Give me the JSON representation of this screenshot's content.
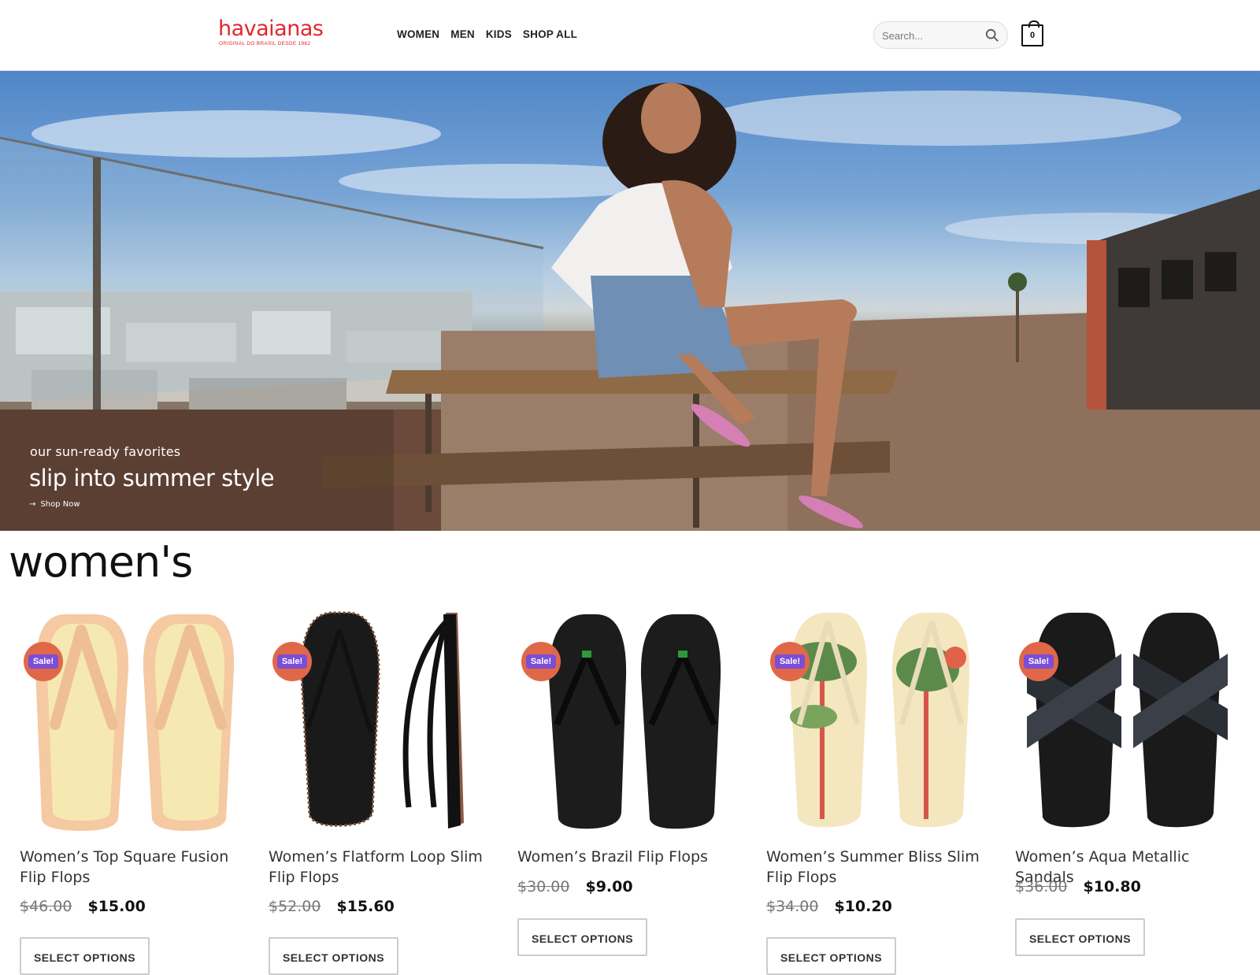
{
  "brand": {
    "name": "havaianas",
    "tagline": "ORIGINAL DO BRASIL DESDE 1962",
    "color": "#e3262f"
  },
  "nav": {
    "items": [
      "WOMEN",
      "MEN",
      "KIDS",
      "SHOP ALL"
    ]
  },
  "search": {
    "placeholder": "Search..."
  },
  "cart": {
    "count": "0"
  },
  "hero": {
    "subtitle": "our sun-ready favorites",
    "title": "slip into summer style",
    "cta": "Shop Now"
  },
  "section": {
    "title": "women's"
  },
  "sale_badge": "Sale!",
  "button_label": "SELECT OPTIONS",
  "colors": {
    "sale_circle": "#e06848",
    "sale_label": "#7c4dd6"
  },
  "products": [
    {
      "name": "Women’s Top Square Fusion Flip Flops",
      "old_price": "$46.00",
      "new_price": "$15.00",
      "colorway": "peach-cream",
      "icon": "flip-flop-peach"
    },
    {
      "name": "Women’s Flatform Loop Slim Flip Flops",
      "old_price": "$52.00",
      "new_price": "$15.60",
      "colorway": "black-platform",
      "icon": "flip-flop-black-platform"
    },
    {
      "name": "Women’s Brazil Flip Flops",
      "old_price": "$30.00",
      "new_price": "$9.00",
      "colorway": "black",
      "icon": "flip-flop-black"
    },
    {
      "name": "Women’s Summer Bliss Slim Flip Flops",
      "old_price": "$34.00",
      "new_price": "$10.20",
      "colorway": "palm-print",
      "icon": "flip-flop-palm"
    },
    {
      "name": "Women’s Aqua Metallic Sandals",
      "old_price": "$36.00",
      "new_price": "$10.80",
      "colorway": "black-metallic",
      "icon": "sandal-crossed-black"
    }
  ]
}
